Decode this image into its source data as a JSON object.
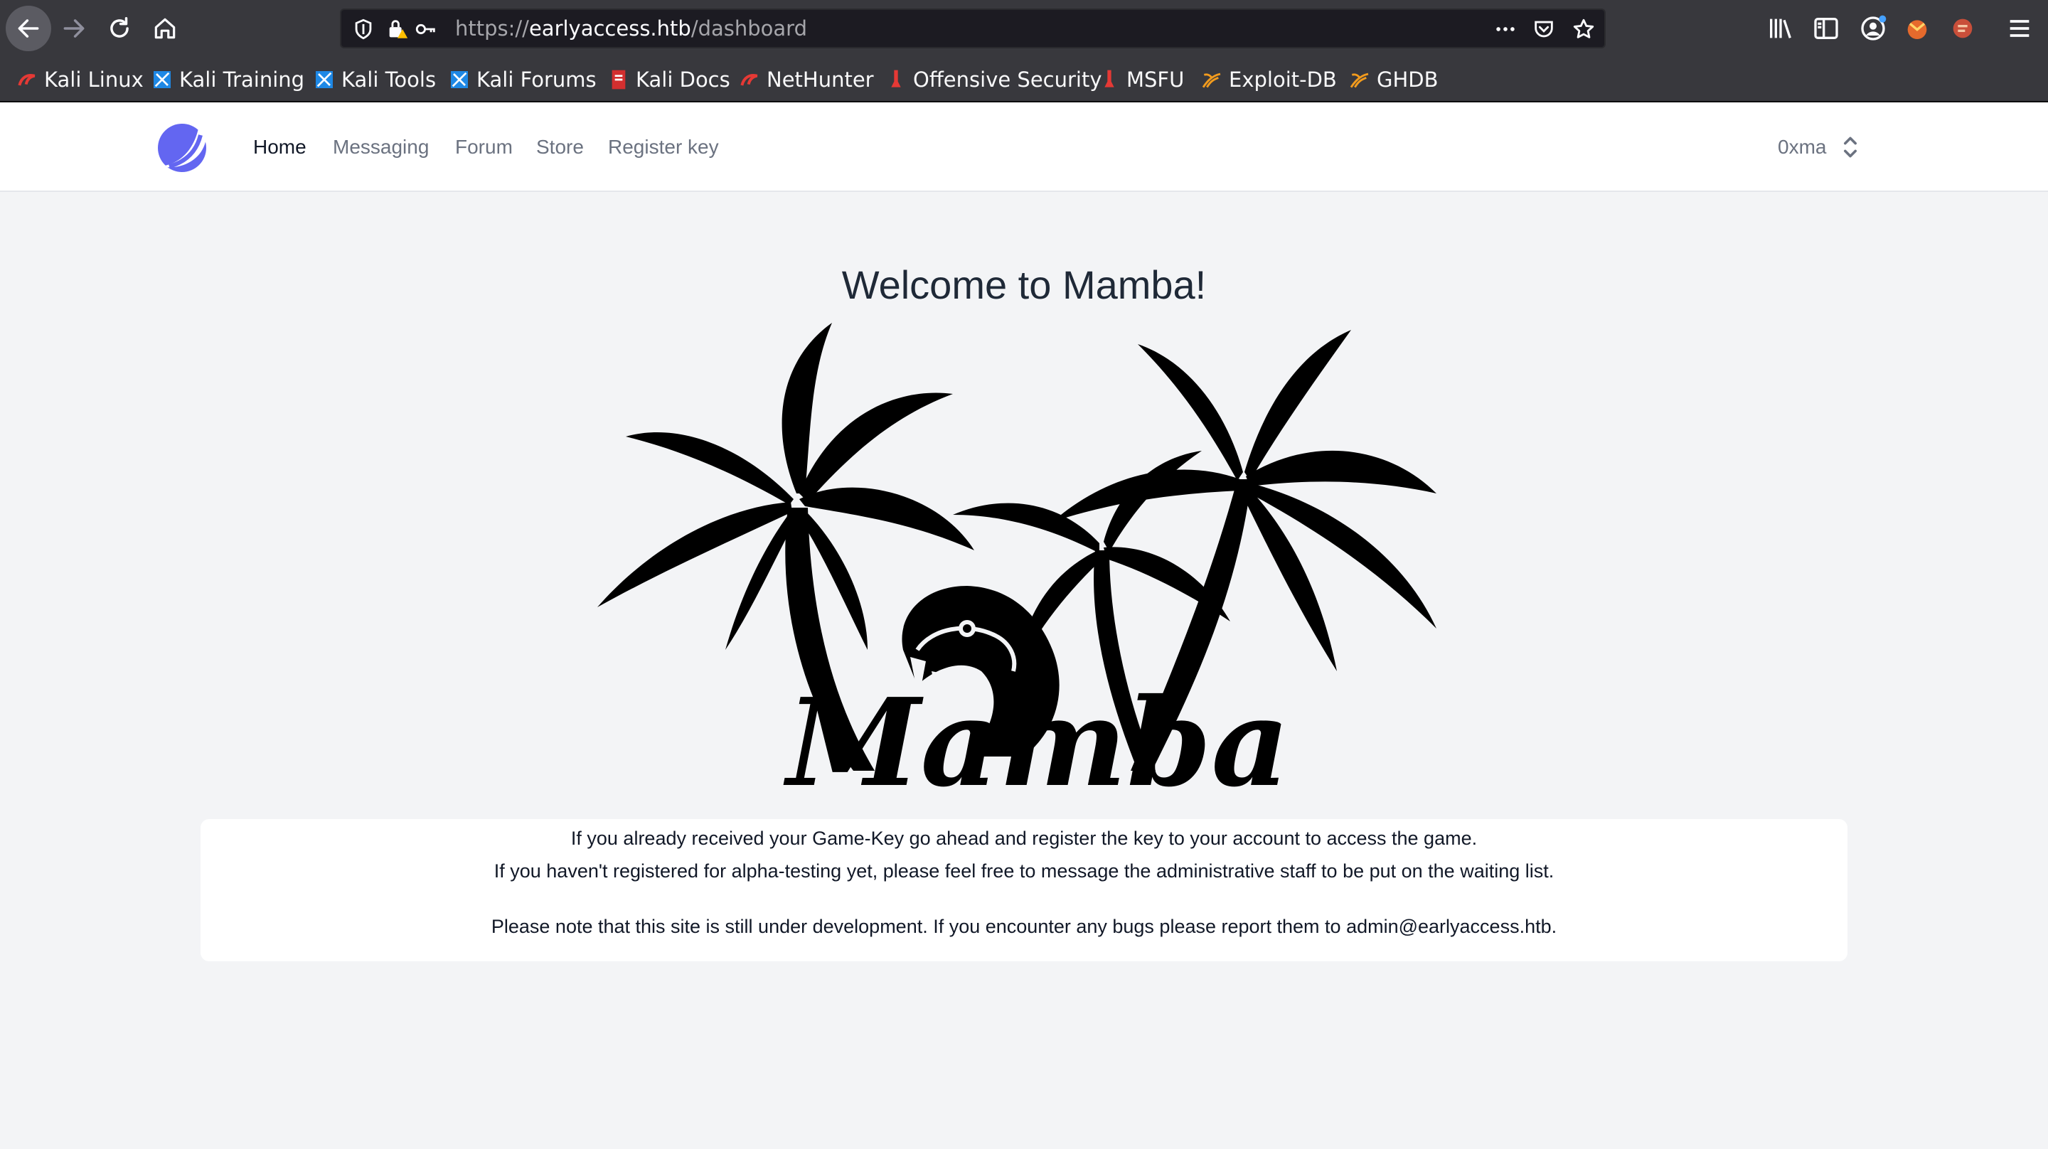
{
  "browser": {
    "url_prefix": "https://",
    "url_host": "earlyaccess.htb",
    "url_path": "/dashboard",
    "icons": [
      "back-arrow-icon",
      "forward-arrow-icon",
      "reload-icon",
      "home-icon",
      "shield-icon",
      "lock-warning-icon",
      "key-icon",
      "more-icon",
      "pocket-icon",
      "star-icon",
      "library-icon",
      "sidebar-icon",
      "account-icon",
      "extension-icon",
      "menu-icon"
    ]
  },
  "bookmarks": [
    {
      "label": "Kali Linux",
      "icon": "kali-icon"
    },
    {
      "label": "Kali Training",
      "icon": "kali-training-icon"
    },
    {
      "label": "Kali Tools",
      "icon": "kali-tools-icon"
    },
    {
      "label": "Kali Forums",
      "icon": "kali-forums-icon"
    },
    {
      "label": "Kali Docs",
      "icon": "kali-docs-icon"
    },
    {
      "label": "NetHunter",
      "icon": "nethunter-icon"
    },
    {
      "label": "Offensive Security",
      "icon": "offsec-icon"
    },
    {
      "label": "MSFU",
      "icon": "msfu-icon"
    },
    {
      "label": "Exploit-DB",
      "icon": "exploitdb-icon"
    },
    {
      "label": "GHDB",
      "icon": "ghdb-icon"
    }
  ],
  "nav": {
    "links": [
      "Home",
      "Messaging",
      "Forum",
      "Store",
      "Register key"
    ],
    "active": "Home",
    "user": "0xma"
  },
  "main": {
    "title": "Welcome to Mamba!",
    "hero_text": "Mamba",
    "info_line1": "If you already received your Game-Key go ahead and register the key to your account to access the game.",
    "info_line2": "If you haven't registered for alpha-testing yet, please feel free to message the administrative staff to be put on the waiting list.",
    "info_line3": "Please note that this site is still under development. If you encounter any bugs please report them to admin@earlyaccess.htb."
  },
  "colors": {
    "chrome": "#38383d",
    "urlbar": "#1c1b22",
    "page_bg": "#f3f4f6",
    "logo": "#6366f1"
  }
}
